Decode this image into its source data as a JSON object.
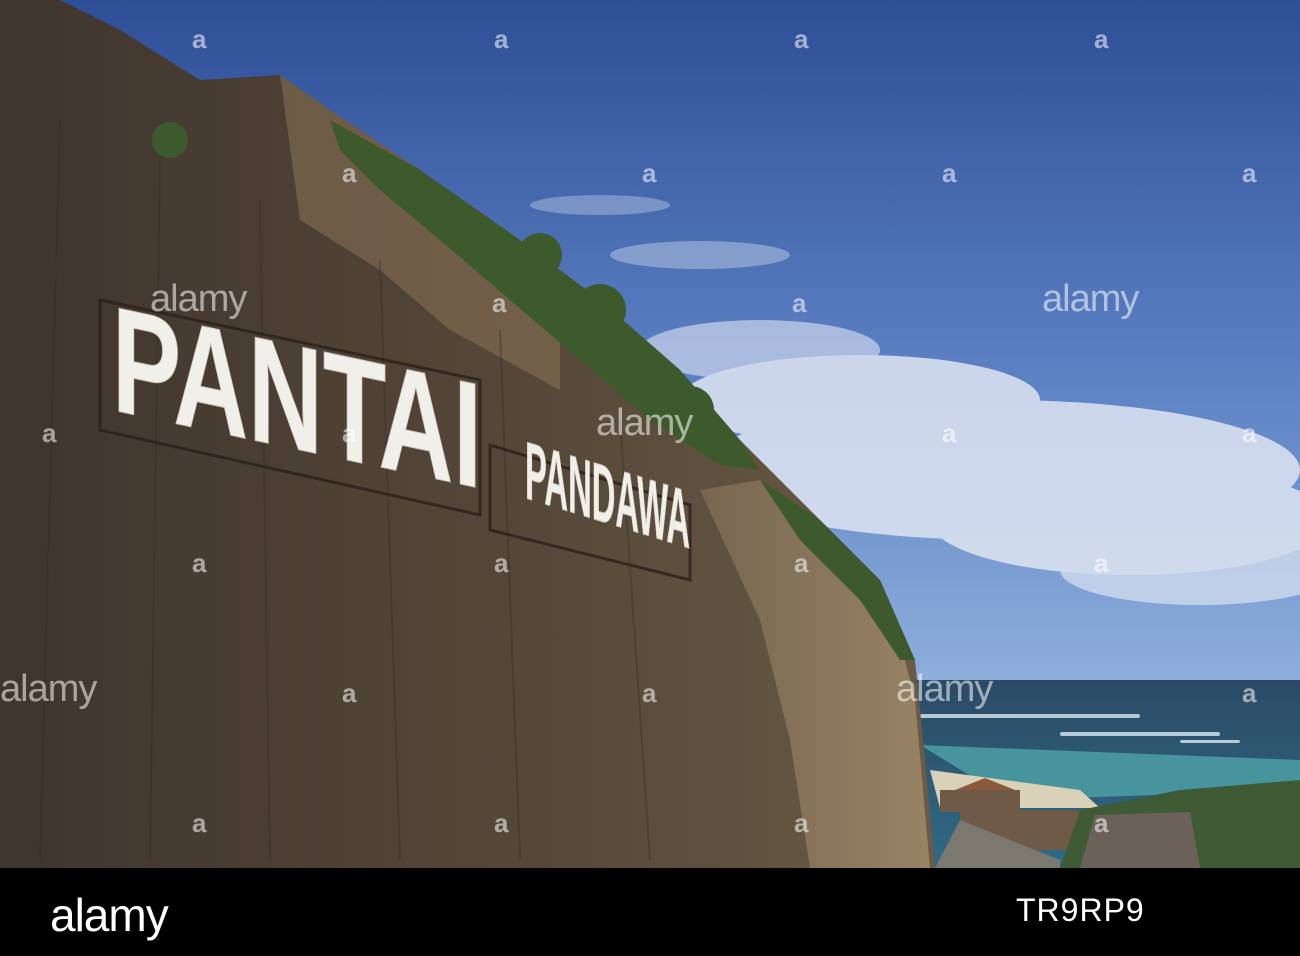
{
  "sign": {
    "word1": "PANTAI",
    "word2": "PANDAWA"
  },
  "watermark": {
    "brand": "alamy",
    "mark": "a"
  },
  "footer": {
    "logo": "alamy",
    "image_id": "TR9RP9"
  },
  "colors": {
    "sky": "#4a6fb8",
    "sea": "#2f5570",
    "cliff": "#4d4136",
    "footer": "#000000"
  }
}
